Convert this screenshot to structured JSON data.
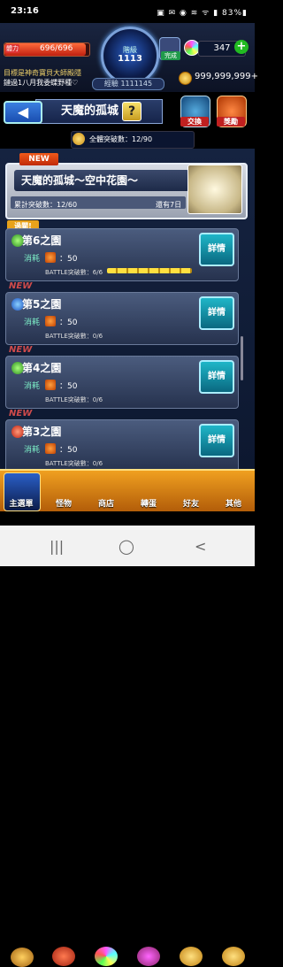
{
  "status_bar": {
    "time": "23:16",
    "indicators": "▣ ✉ ◉ ≋ ᯤ ▮",
    "battery": "83%▮"
  },
  "player": {
    "stamina_label": "體力",
    "stamina": "696/696",
    "rank_label": "階級",
    "rank": "1113",
    "exp": "經驗 1111145",
    "complete_label": "完成",
    "orbs": "347",
    "gold": "999,999,999+",
    "news_line1": "目標是神奇寶貝大師殿隱",
    "news_line2": "鏈過1八月我委蝶野種♡"
  },
  "title": {
    "back_label": "◀",
    "text": "天魔的孤城",
    "help_label": "?"
  },
  "side_nav": {
    "exchange_label": "交換",
    "reward_label": "獎勵"
  },
  "total_breakthrough": "全體突破數：12/90",
  "stage": {
    "new_label": "NEW",
    "title": "天魔的孤城～空中花園～",
    "breakthrough": "累計突破數：12/60",
    "remaining": "還有7日"
  },
  "gardens": [
    {
      "badge": "過關!",
      "name": "第6之園",
      "cost_label": "消耗",
      "cost": "：50",
      "battle": "BATTLE突破數：6/6",
      "progress": 1.0,
      "detail": "詳情"
    },
    {
      "badge": "NEW",
      "name": "第5之園",
      "cost_label": "消耗",
      "cost": "：50",
      "battle": "BATTLE突破數：0/6",
      "progress": 0.0,
      "detail": "詳情"
    },
    {
      "badge": "NEW",
      "name": "第4之園",
      "cost_label": "消耗",
      "cost": "：50",
      "battle": "BATTLE突破數：0/6",
      "progress": 0.0,
      "detail": "詳情"
    },
    {
      "badge": "NEW",
      "name": "第3之園",
      "cost_label": "消耗",
      "cost": "：50",
      "battle": "BATTLE突破數：0/6",
      "progress": 0.0,
      "detail": "詳情"
    }
  ],
  "bottom_nav": [
    {
      "label": "主選單",
      "icon": "castle-icon"
    },
    {
      "label": "怪物",
      "icon": "monster-icon"
    },
    {
      "label": "商店",
      "icon": "shop-icon"
    },
    {
      "label": "轉蛋",
      "icon": "gacha-icon"
    },
    {
      "label": "好友",
      "icon": "friends-icon"
    },
    {
      "label": "其他",
      "icon": "other-icon"
    }
  ],
  "system_nav": {
    "recents": "|||",
    "home": "◯",
    "back": "<"
  },
  "colors": {
    "accent_orange": "#e8901a",
    "detail_cyan": "#1fb6c8",
    "new_red": "#d04b4b",
    "cost_green": "#7df0c8"
  }
}
